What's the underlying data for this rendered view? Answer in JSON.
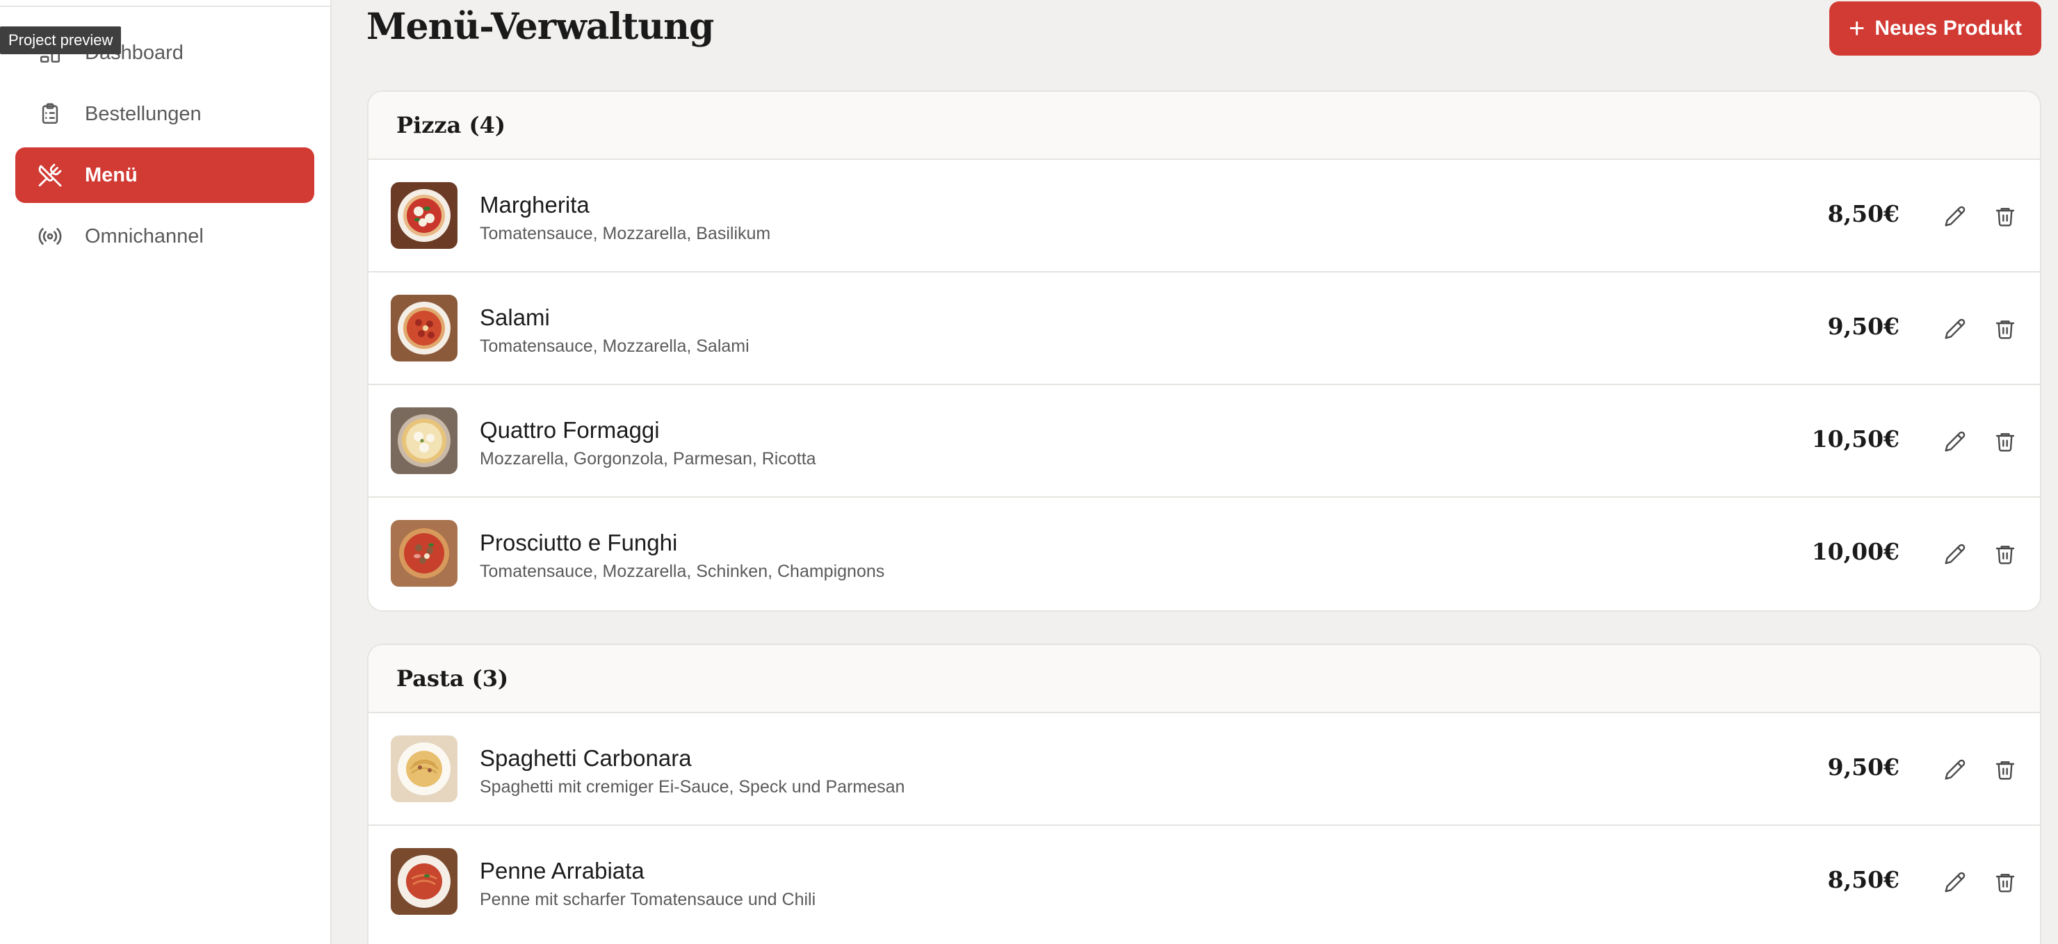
{
  "tooltip": "Project preview",
  "sidebar": {
    "items": [
      {
        "label": "Dashboard",
        "icon": "dashboard-icon",
        "active": false
      },
      {
        "label": "Bestellungen",
        "icon": "clipboard-icon",
        "active": false
      },
      {
        "label": "Menü",
        "icon": "utensils-icon",
        "active": true
      },
      {
        "label": "Omnichannel",
        "icon": "broadcast-icon",
        "active": false
      }
    ]
  },
  "header": {
    "title": "Menü-Verwaltung",
    "new_button_label": "Neues Produkt",
    "new_button_icon": "plus-icon"
  },
  "colors": {
    "accent": "#d23a34",
    "background": "#f1f0ee",
    "card": "#ffffff"
  },
  "categories": [
    {
      "title": "Pizza (4)",
      "items": [
        {
          "name": "Margherita",
          "desc": "Tomatensauce, Mozzarella, Basilikum",
          "price": "8,50€"
        },
        {
          "name": "Salami",
          "desc": "Tomatensauce, Mozzarella, Salami",
          "price": "9,50€"
        },
        {
          "name": "Quattro Formaggi",
          "desc": "Mozzarella, Gorgonzola, Parmesan, Ricotta",
          "price": "10,50€"
        },
        {
          "name": "Prosciutto e Funghi",
          "desc": "Tomatensauce, Mozzarella, Schinken, Champignons",
          "price": "10,00€"
        }
      ]
    },
    {
      "title": "Pasta (3)",
      "items": [
        {
          "name": "Spaghetti Carbonara",
          "desc": "Spaghetti mit cremiger Ei-Sauce, Speck und Parmesan",
          "price": "9,50€"
        },
        {
          "name": "Penne Arrabiata",
          "desc": "Penne mit scharfer Tomatensauce und Chili",
          "price": "8,50€"
        }
      ]
    }
  ]
}
